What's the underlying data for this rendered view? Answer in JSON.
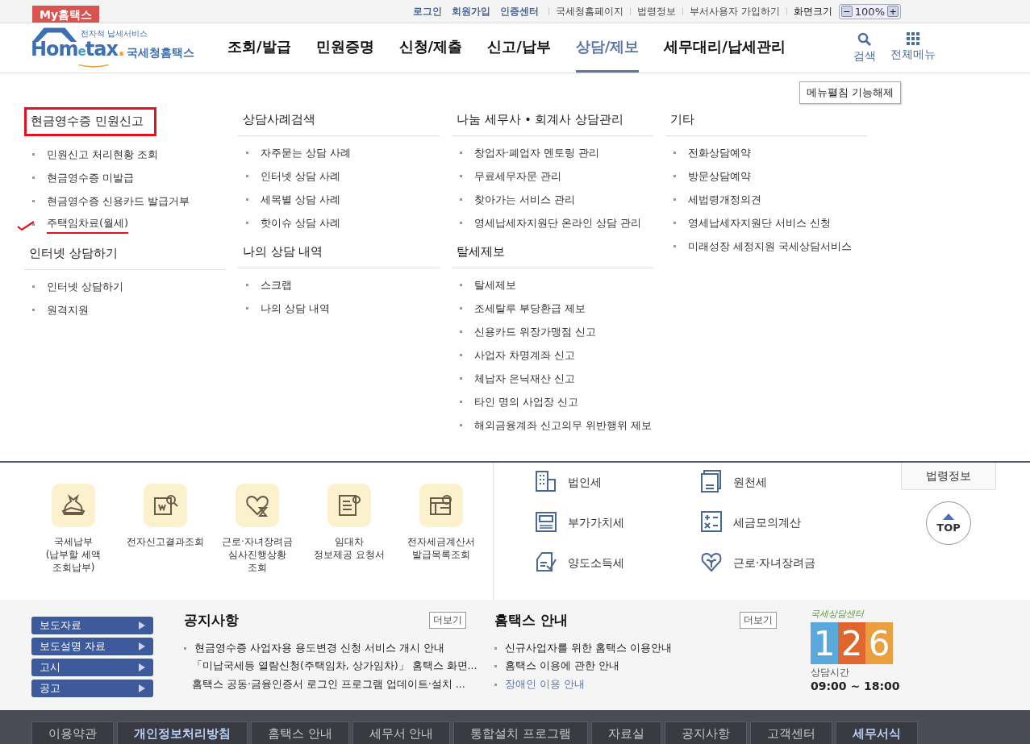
{
  "top_bar": {
    "my_button": "My홈택스",
    "links": [
      {
        "label": "로그인",
        "strong": true
      },
      {
        "label": "회원가입",
        "strong": true
      },
      {
        "label": "인증센터",
        "strong": true
      },
      {
        "label": "국세청홈페이지",
        "strong": false
      },
      {
        "label": "법령정보",
        "strong": false
      },
      {
        "label": "부서사용자 가입하기",
        "strong": false
      }
    ],
    "zoom_label": "화면크기",
    "zoom_minus": "−",
    "zoom_value": "100%",
    "zoom_plus": "+"
  },
  "header": {
    "logo": {
      "tagline": "전자적 납세서비스",
      "word_start": "Hom",
      "word_small": "e",
      "word_end": "tax",
      "dot": ".",
      "name": "국세청홈택스"
    },
    "nav": [
      {
        "label": "조회/발급",
        "selected": false
      },
      {
        "label": "민원증명",
        "selected": false
      },
      {
        "label": "신청/제출",
        "selected": false
      },
      {
        "label": "신고/납부",
        "selected": false
      },
      {
        "label": "상담/제보",
        "selected": true
      },
      {
        "label": "세무대리/납세관리",
        "selected": false
      }
    ],
    "search": "검색",
    "all_menu": "전체메뉴"
  },
  "mega_menu": {
    "collapse_button": "메뉴펼침 기능해제",
    "columns": [
      [
        {
          "title": "현금영수증 민원신고",
          "boxed": true,
          "items": [
            {
              "label": "민원신고 처리현황 조회",
              "marked": false
            },
            {
              "label": "현금영수증 미발급",
              "marked": false
            },
            {
              "label": "현금영수증 신용카드 발급거부",
              "marked": false
            },
            {
              "label": "주택임차료(월세)",
              "marked": true
            }
          ]
        },
        {
          "title": "인터넷 상담하기",
          "boxed": false,
          "items": [
            {
              "label": "인터넷 상담하기",
              "marked": false
            },
            {
              "label": "원격지원",
              "marked": false
            }
          ]
        }
      ],
      [
        {
          "title": "상담사례검색",
          "boxed": false,
          "items": [
            {
              "label": "자주묻는 상담 사례",
              "marked": false
            },
            {
              "label": "인터넷 상담 사례",
              "marked": false
            },
            {
              "label": "세목별 상담 사례",
              "marked": false
            },
            {
              "label": "핫이슈 상담 사례",
              "marked": false
            }
          ]
        },
        {
          "title": "나의 상담 내역",
          "boxed": false,
          "items": [
            {
              "label": "스크랩",
              "marked": false
            },
            {
              "label": "나의 상담 내역",
              "marked": false
            }
          ]
        }
      ],
      [
        {
          "title": "나눔 세무사 • 회계사 상담관리",
          "boxed": false,
          "items": [
            {
              "label": "창업자·폐업자 멘토링 관리",
              "marked": false
            },
            {
              "label": "무료세무자문 관리",
              "marked": false
            },
            {
              "label": "찾아가는 서비스 관리",
              "marked": false
            },
            {
              "label": "영세납세자지원단 온라인 상담 관리",
              "marked": false
            }
          ]
        },
        {
          "title": "탈세제보",
          "boxed": false,
          "items": [
            {
              "label": "탈세제보",
              "marked": false
            },
            {
              "label": "조세탈루 부당환급 제보",
              "marked": false
            },
            {
              "label": "신용카드 위장가맹점 신고",
              "marked": false
            },
            {
              "label": "사업자 차명계좌 신고",
              "marked": false
            },
            {
              "label": "체납자 은닉재산 신고",
              "marked": false
            },
            {
              "label": "타인 명의 사업장 신고",
              "marked": false
            },
            {
              "label": "해외금융계좌 신고의무 위반행위 제보",
              "marked": false
            }
          ]
        }
      ],
      [
        {
          "title": "기타",
          "boxed": false,
          "items": [
            {
              "label": "전화상담예약",
              "marked": false
            },
            {
              "label": "방문상담예약",
              "marked": false
            },
            {
              "label": "세법령개정의견",
              "marked": false
            },
            {
              "label": "영세납세자지원단 서비스 신청",
              "marked": false
            },
            {
              "label": "미래성장 세정지원 국세상담서비스",
              "marked": false
            }
          ]
        }
      ]
    ]
  },
  "quick_services": [
    {
      "kind": "bag",
      "lines": [
        "국세납부",
        "(납부할 세액",
        "조회납부)"
      ]
    },
    {
      "kind": "search-doc",
      "lines": [
        "전자신고결과조회"
      ]
    },
    {
      "kind": "heart",
      "lines": [
        "근로·자녀장려금",
        "심사진행상황",
        "조회"
      ]
    },
    {
      "kind": "certificate",
      "lines": [
        "임대차",
        "정보제공 요청서"
      ]
    },
    {
      "kind": "invoice",
      "lines": [
        "전자세금계산서",
        "발급목록조회"
      ]
    }
  ],
  "tax_links": [
    {
      "kind": "building",
      "label": "법인세"
    },
    {
      "kind": "sal",
      "label": "원천세"
    },
    {
      "kind": "vat",
      "label": "부가가치세"
    },
    {
      "kind": "calculator",
      "label": "세금모의계산"
    },
    {
      "kind": "transfer",
      "label": "양도소득세"
    },
    {
      "kind": "heart",
      "label": "근로·자녀장려금"
    }
  ],
  "law_button": "법령정보",
  "top_button": "TOP",
  "side_menu": [
    "보도자료",
    "보도설명 자료",
    "고시",
    "공고"
  ],
  "boards": [
    {
      "title": "공지사항",
      "more": "더보기",
      "items": [
        {
          "label": "현금영수증 사업자용 용도변경 신청 서비스 개시 안내",
          "link": false
        },
        {
          "label": "「미납국세등 열람신청(주택임차, 상가임차)」 홈택스 화면...",
          "link": false
        },
        {
          "label": "홈택스 공동·금융인증서 로그인 프로그램 업데이트·설치 ...",
          "link": false
        }
      ]
    },
    {
      "title": "홈택스 안내",
      "more": "더보기",
      "items": [
        {
          "label": "신규사업자를 위한 홈택스 이용안내",
          "link": false
        },
        {
          "label": "홈택스 이용에 관한 안내",
          "link": false
        },
        {
          "label": "장애인 이용 안내",
          "link": true
        }
      ]
    }
  ],
  "call_center": {
    "title": "국세상담센터",
    "number": "126",
    "hours_label": "상담시간",
    "hours": "09:00 ~ 18:00"
  },
  "footer": [
    {
      "label": "이용약관",
      "strong": false
    },
    {
      "label": "개인정보처리방침",
      "strong": true
    },
    {
      "label": "홈택스 안내",
      "strong": false
    },
    {
      "label": "세무서 안내",
      "strong": false
    },
    {
      "label": "통합설치 프로그램",
      "strong": false
    },
    {
      "label": "자료실",
      "strong": false
    },
    {
      "label": "공지사항",
      "strong": false
    },
    {
      "label": "고객센터",
      "strong": false
    },
    {
      "label": "세무서식",
      "strong": true
    }
  ]
}
